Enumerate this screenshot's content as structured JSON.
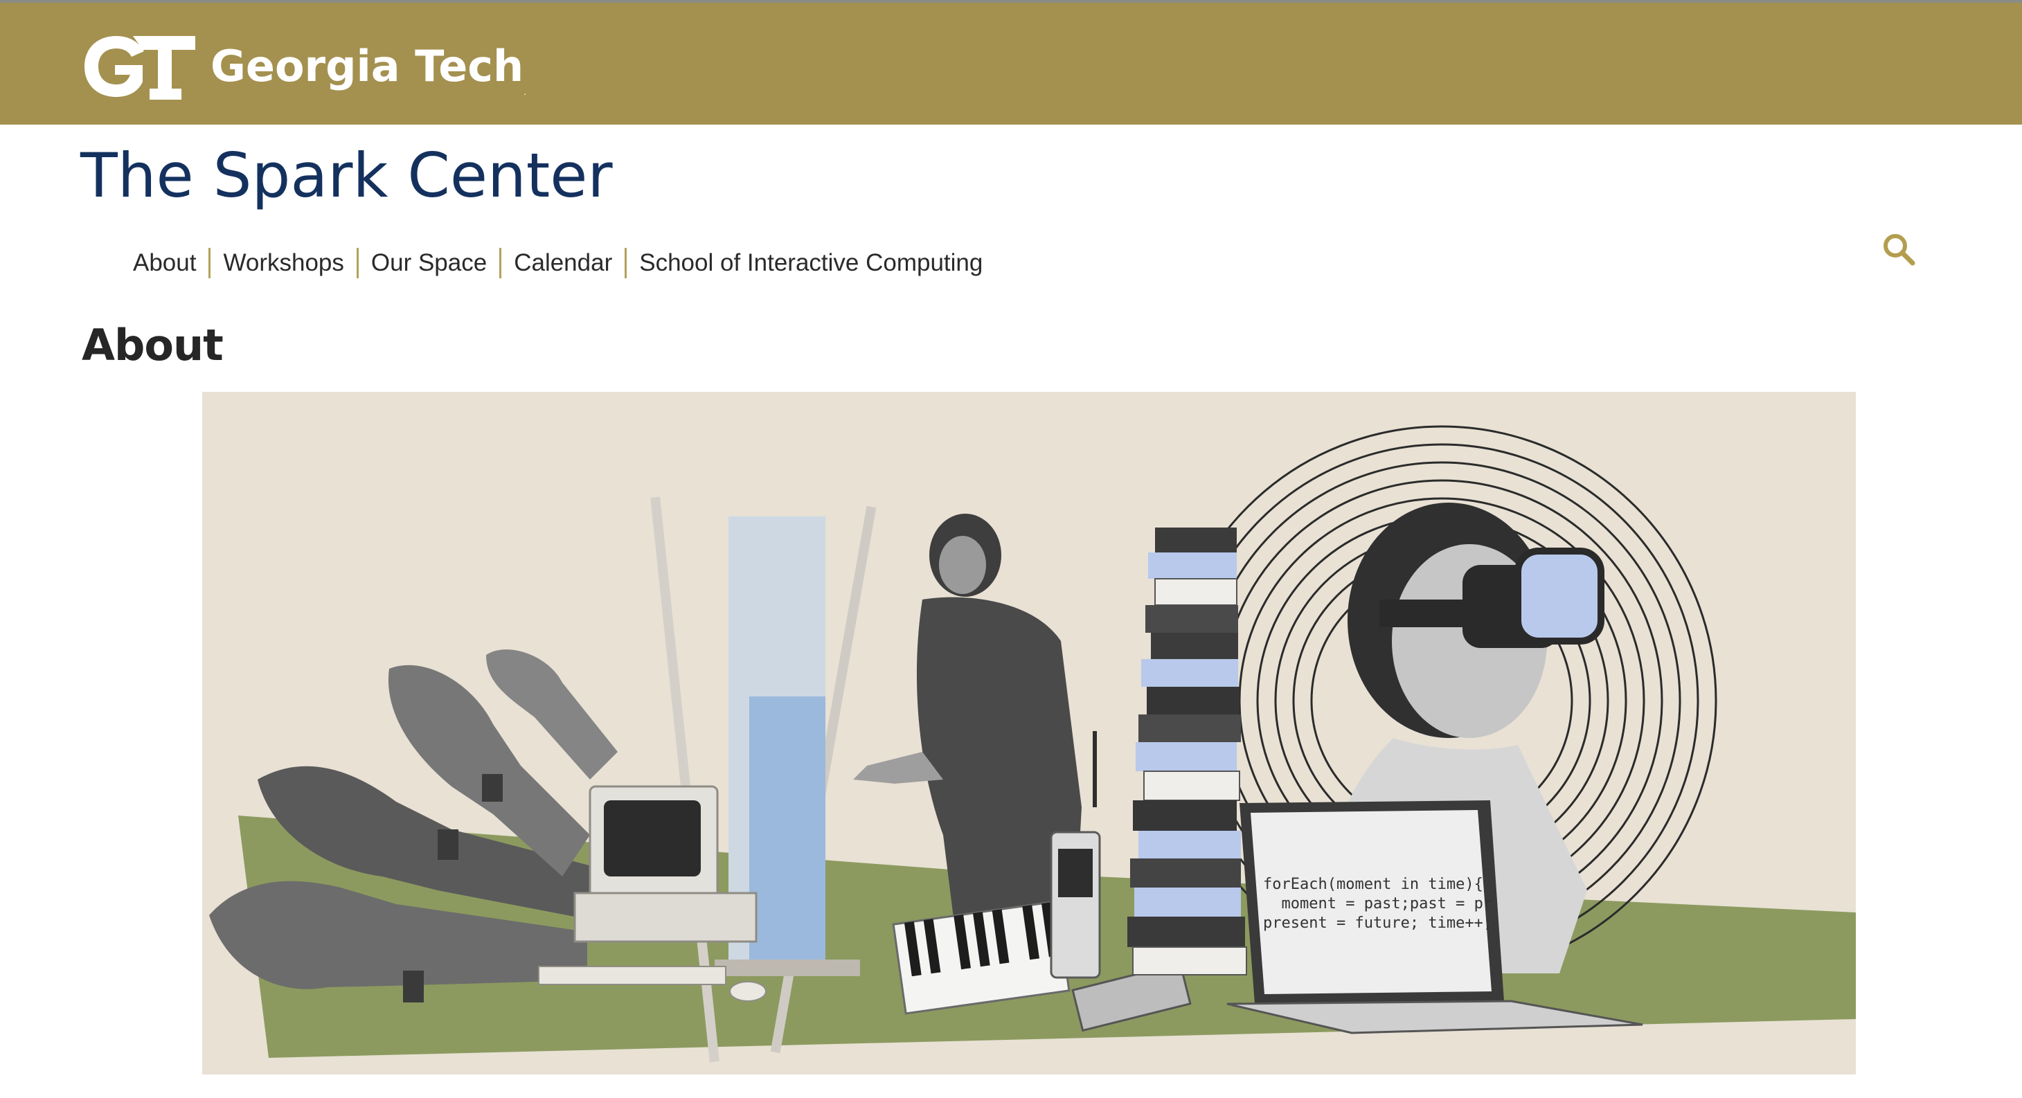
{
  "header": {
    "brand": "Georgia Tech",
    "brand_tm": ".",
    "brand_color": "#a4914f"
  },
  "site": {
    "title": "The Spark Center",
    "title_color": "#14315e"
  },
  "nav": {
    "items": [
      {
        "label": "About"
      },
      {
        "label": "Workshops"
      },
      {
        "label": "Our Space"
      },
      {
        "label": "Calendar"
      },
      {
        "label": "School of Interactive Computing"
      }
    ],
    "separator_color": "#b3a05d",
    "search_icon": "search-icon"
  },
  "page": {
    "heading": "About"
  },
  "hero": {
    "code_lines": [
      "forEach(moment in time){",
      "  moment = past;past = pr",
      "present = future; time++;"
    ],
    "background_color": "#e8e1d4",
    "accent_green": "#8c9a5f",
    "accent_blue": "#b8c9ec"
  }
}
